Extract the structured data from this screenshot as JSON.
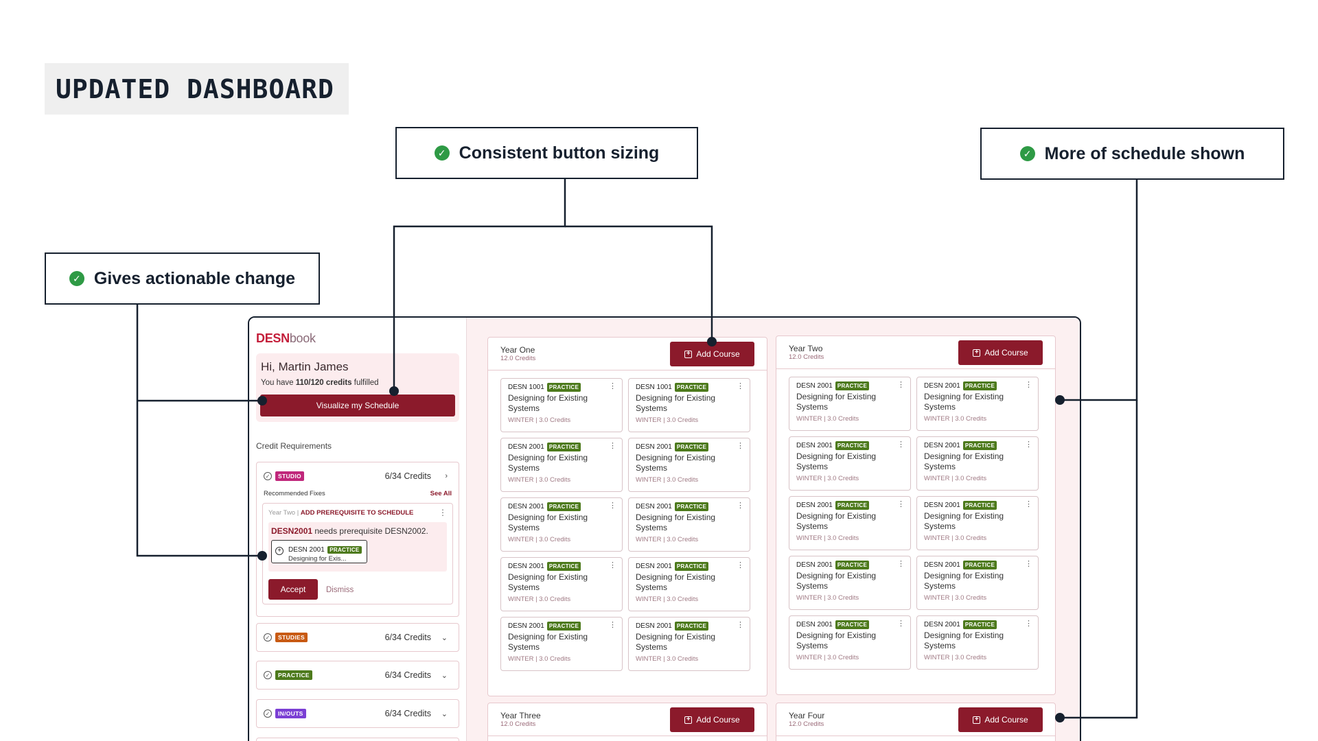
{
  "page_title": "UPDATED DASHBOARD",
  "callouts": {
    "button_sizing": "Consistent button sizing",
    "schedule": "More of schedule shown",
    "actionable": "Gives actionable change"
  },
  "colors": {
    "accent": "#8b1a2b",
    "check": "#2e9a45",
    "brand": "#c41e3a"
  },
  "app": {
    "logo_bold": "DESN",
    "logo_light": "book",
    "greeting": "Hi, Martin James",
    "credits_prefix": "You have ",
    "credits_value": "110/120 credits",
    "credits_suffix": " fulfilled",
    "visualize_button": "Visualize my Schedule",
    "credit_requirements_label": "Credit Requirements",
    "requirements": [
      {
        "tag": "STUDIO",
        "credits": "6/34 Credits",
        "chevron": "›"
      },
      {
        "tag": "STUDIES",
        "credits": "6/34 Credits",
        "chevron": "⌄"
      },
      {
        "tag": "PRACTICE",
        "credits": "6/34 Credits",
        "chevron": "⌄"
      },
      {
        "tag": "IN/OUTS",
        "credits": "6/34 Credits",
        "chevron": "⌄"
      }
    ],
    "recommended_label": "Recommended Fixes",
    "see_all": "See All",
    "fix": {
      "year": "Year Two | ",
      "action": "ADD PREREQUISITE TO SCHEDULE",
      "course_code": "DESN2001",
      "message": " needs prerequisite DESN2002.",
      "mini_code": "DESN 2001",
      "mini_tag": "PRACTICE",
      "mini_name": "Designing for Exis...",
      "accept": "Accept",
      "dismiss": "Dismiss"
    },
    "add_course_label": "Add Course",
    "years": [
      {
        "name": "Year One",
        "credits": "12.0 Credits",
        "courses": [
          {
            "code": "DESN 1001",
            "tag": "PRACTICE",
            "name": "Designing for Existing Systems",
            "meta": "WINTER | 3.0 Credits"
          },
          {
            "code": "DESN 1001",
            "tag": "PRACTICE",
            "name": "Designing for Existing Systems",
            "meta": "WINTER | 3.0 Credits"
          },
          {
            "code": "DESN 2001",
            "tag": "PRACTICE",
            "name": "Designing for Existing Systems",
            "meta": "WINTER | 3.0 Credits"
          },
          {
            "code": "DESN 2001",
            "tag": "PRACTICE",
            "name": "Designing for Existing Systems",
            "meta": "WINTER | 3.0 Credits"
          },
          {
            "code": "DESN 2001",
            "tag": "PRACTICE",
            "name": "Designing for Existing Systems",
            "meta": "WINTER | 3.0 Credits"
          },
          {
            "code": "DESN 2001",
            "tag": "PRACTICE",
            "name": "Designing for Existing Systems",
            "meta": "WINTER | 3.0 Credits"
          },
          {
            "code": "DESN 2001",
            "tag": "PRACTICE",
            "name": "Designing for Existing Systems",
            "meta": "WINTER | 3.0 Credits"
          },
          {
            "code": "DESN 2001",
            "tag": "PRACTICE",
            "name": "Designing for Existing Systems",
            "meta": "WINTER | 3.0 Credits"
          },
          {
            "code": "DESN 2001",
            "tag": "PRACTICE",
            "name": "Designing for Existing Systems",
            "meta": "WINTER | 3.0 Credits"
          },
          {
            "code": "DESN 2001",
            "tag": "PRACTICE",
            "name": "Designing for Existing Systems",
            "meta": "WINTER | 3.0 Credits"
          }
        ]
      },
      {
        "name": "Year Two",
        "credits": "12.0 Credits",
        "courses": [
          {
            "code": "DESN 2001",
            "tag": "PRACTICE",
            "name": "Designing for Existing Systems",
            "meta": "WINTER | 3.0 Credits"
          },
          {
            "code": "DESN 2001",
            "tag": "PRACTICE",
            "name": "Designing for Existing Systems",
            "meta": "WINTER | 3.0 Credits"
          },
          {
            "code": "DESN 2001",
            "tag": "PRACTICE",
            "name": "Designing for Existing Systems",
            "meta": "WINTER | 3.0 Credits"
          },
          {
            "code": "DESN 2001",
            "tag": "PRACTICE",
            "name": "Designing for Existing Systems",
            "meta": "WINTER | 3.0 Credits"
          },
          {
            "code": "DESN 2001",
            "tag": "PRACTICE",
            "name": "Designing for Existing Systems",
            "meta": "WINTER | 3.0 Credits"
          },
          {
            "code": "DESN 2001",
            "tag": "PRACTICE",
            "name": "Designing for Existing Systems",
            "meta": "WINTER | 3.0 Credits"
          },
          {
            "code": "DESN 2001",
            "tag": "PRACTICE",
            "name": "Designing for Existing Systems",
            "meta": "WINTER | 3.0 Credits"
          },
          {
            "code": "DESN 2001",
            "tag": "PRACTICE",
            "name": "Designing for Existing Systems",
            "meta": "WINTER | 3.0 Credits"
          },
          {
            "code": "DESN 2001",
            "tag": "PRACTICE",
            "name": "Designing for Existing Systems",
            "meta": "WINTER | 3.0 Credits"
          },
          {
            "code": "DESN 2001",
            "tag": "PRACTICE",
            "name": "Designing for Existing Systems",
            "meta": "WINTER | 3.0 Credits"
          }
        ]
      },
      {
        "name": "Year Three",
        "credits": "12.0 Credits",
        "courses": []
      },
      {
        "name": "Year Four",
        "credits": "12.0 Credits",
        "courses": []
      }
    ]
  }
}
